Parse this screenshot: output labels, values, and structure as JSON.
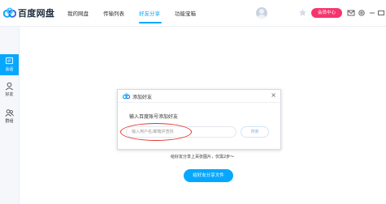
{
  "app": {
    "title": "百度网盘"
  },
  "nav": {
    "tabs": [
      "我的网盘",
      "传输列表",
      "好友分享",
      "功能宝箱"
    ],
    "active_tab": "好友分享"
  },
  "header": {
    "member_button": "会员中心"
  },
  "sidebar": {
    "items": [
      {
        "label": "会话",
        "icon": "chat-icon"
      },
      {
        "label": "好友",
        "icon": "person-icon"
      },
      {
        "label": "群组",
        "icon": "group-icon"
      }
    ]
  },
  "dialog": {
    "title": "添加好友",
    "close": "×",
    "label": "输入百度账号添加好友",
    "input_placeholder": "输入用户名/邮箱并查找",
    "search_button": "搜索"
  },
  "main": {
    "hint": "给好友分享上百张图片，仅需2步～",
    "share_button": "给好友分享文件"
  },
  "colors": {
    "accent": "#06a7ff",
    "member_badge": "#f5356f",
    "annotation": "#e0352e"
  }
}
